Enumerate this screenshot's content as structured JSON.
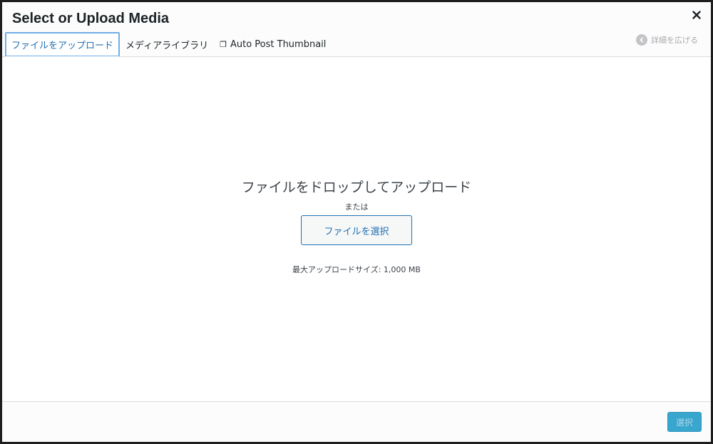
{
  "modal": {
    "title": "Select or Upload Media",
    "close_label": "close-icon"
  },
  "tabs": [
    {
      "label": "ファイルをアップロード",
      "active": true
    },
    {
      "label": "メディアライブラリ",
      "active": false
    },
    {
      "label": "Auto Post Thumbnail",
      "active": false,
      "icon": "external-window-icon"
    }
  ],
  "expand_details": {
    "label": "詳細を広げる",
    "icon": "chevron-left-icon"
  },
  "uploader": {
    "drop_instructions": "ファイルをドロップしてアップロード",
    "or_text": "または",
    "select_files_label": "ファイルを選択",
    "max_size": "最大アップロードサイズ: 1,000 MB"
  },
  "footer": {
    "select_label": "選択",
    "select_disabled": true
  },
  "colors": {
    "accent": "#2271b1",
    "primary_button": "#2ea2cc",
    "backdrop": "#1e1e1e"
  }
}
